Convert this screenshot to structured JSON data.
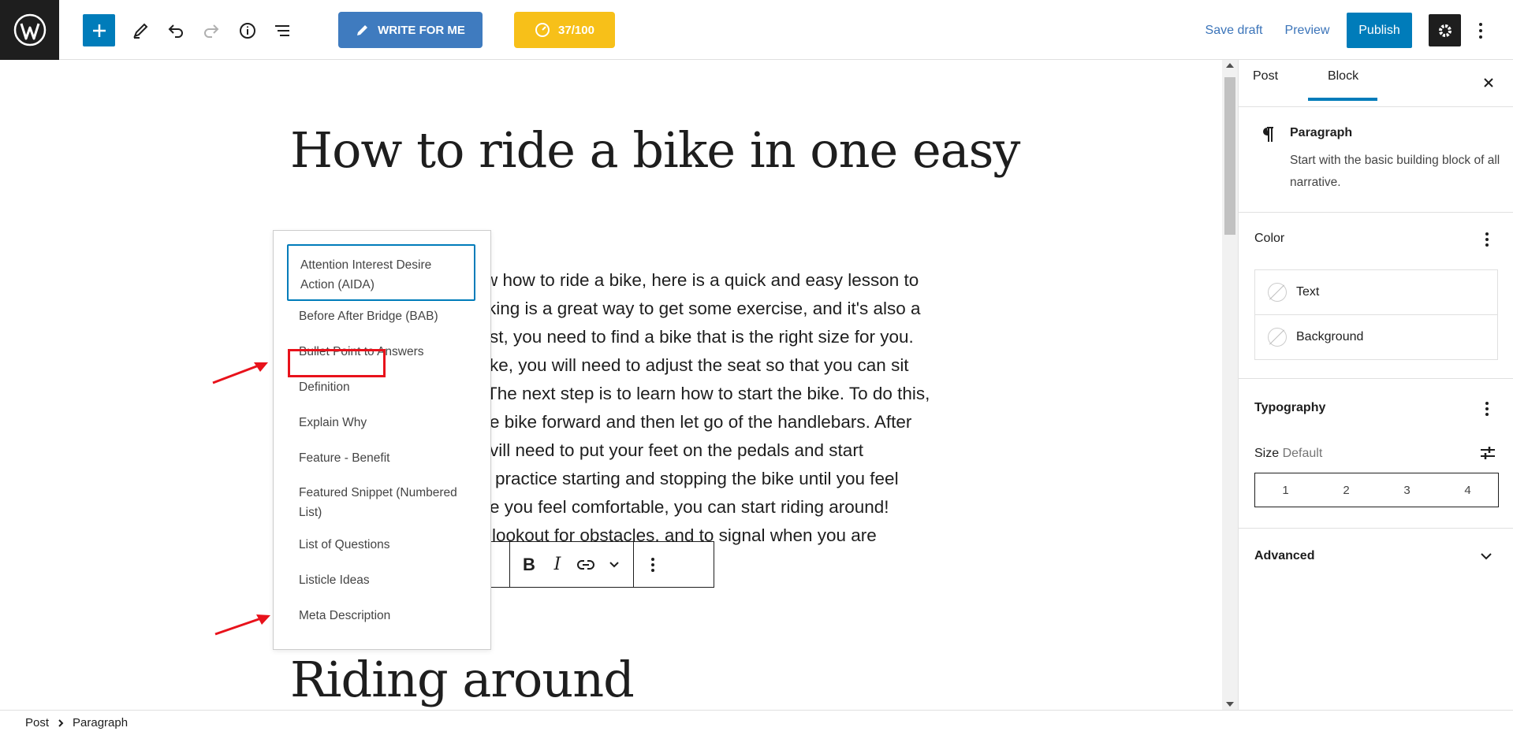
{
  "toolbar": {
    "write_label": "WRITE FOR ME",
    "score_label": "37/100",
    "save_draft": "Save draft",
    "preview": "Preview",
    "publish": "Publish"
  },
  "editor": {
    "title": "How to ride a bike in one easy",
    "paragraph_lines": [
      "w how to ride a bike, here is a quick and easy lesson to",
      "king is a great way to get some exercise, and it's also a",
      "st, you need to find a bike that is the right size for you.",
      "ke, you will need to adjust the seat so that you can sit",
      "The next step is to learn how to start the bike. To do this,",
      "e bike forward and then let go of the handlebars. After",
      "vill need to put your feet on the pedals and start",
      "practice starting and stopping the bike until you feel",
      "e you feel comfortable, you can start riding around!",
      "lookout for obstacles, and to signal when you are"
    ],
    "slash_input": "\\",
    "heading2": "Riding around"
  },
  "dropdown": {
    "items": [
      "Attention Interest Desire Action (AIDA)",
      "Before After Bridge (BAB)",
      "Bullet Point to Answers",
      "Definition",
      "Explain Why",
      "Feature - Benefit",
      "Featured Snippet (Numbered List)",
      "List of Questions",
      "Listicle Ideas",
      "Meta Description"
    ]
  },
  "block_toolbar": {
    "bold": "B",
    "italic": "I"
  },
  "sidebar": {
    "tabs": [
      "Post",
      "Block"
    ],
    "active_tab": "Block",
    "block_name": "Paragraph",
    "block_desc": "Start with the basic building block of all narrative.",
    "color_title": "Color",
    "color_text": "Text",
    "color_background": "Background",
    "typography_title": "Typography",
    "size_label": "Size",
    "size_value": "Default",
    "size_options": [
      "1",
      "2",
      "3",
      "4"
    ],
    "advanced_title": "Advanced"
  },
  "footer": {
    "breadcrumb": [
      "Post",
      "Paragraph"
    ]
  },
  "colors": {
    "accent": "#007cba",
    "write_button": "#3f7bbf",
    "score_button": "#f7c019",
    "annotation_red": "#e8121b",
    "dark": "#1e1e1e"
  }
}
